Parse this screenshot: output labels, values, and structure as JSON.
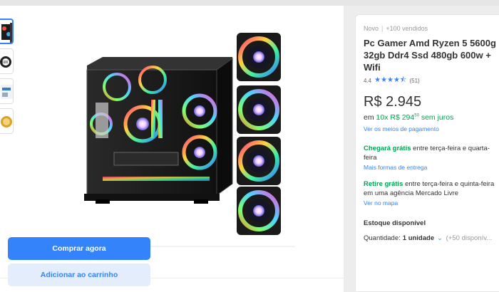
{
  "product": {
    "condition": "Novo",
    "separator": "|",
    "sold": "+100 vendidos",
    "title": "Pc Gamer Amd Ryzen 5 5600g 32gb Ddr4 Ssd 480gb 600w + Wifi",
    "rating_value": "4.4",
    "rating_stars": 4.4,
    "reviews_count": "(51)",
    "price": "R$ 2.945",
    "installments_prefix": "em",
    "installments_value": "10x R$ 294",
    "installments_cents": "50",
    "installments_suffix": "sem juros",
    "payment_link": "Ver os meios de pagamento"
  },
  "shipping": {
    "highlight": "Chegará grátis",
    "text": "entre terça-feira e quarta-feira",
    "link": "Mais formas de entrega"
  },
  "pickup": {
    "highlight": "Retire grátis",
    "text": "entre terça-feira e quinta-feira em uma agência Mercado Livre",
    "link": "Ver no mapa"
  },
  "stock": {
    "title": "Estoque disponível",
    "quantity_label": "Quantidade:",
    "quantity_value": "1 unidade",
    "available": "(+50 disponív..."
  },
  "actions": {
    "buy_now": "Comprar agora",
    "add_to_cart": "Adicionar ao carrinho"
  },
  "icons": {
    "stars": "star-icon",
    "quantity_dropdown": "chevron-down-icon"
  },
  "colors": {
    "accent": "#3483fa",
    "green": "#00a650"
  }
}
